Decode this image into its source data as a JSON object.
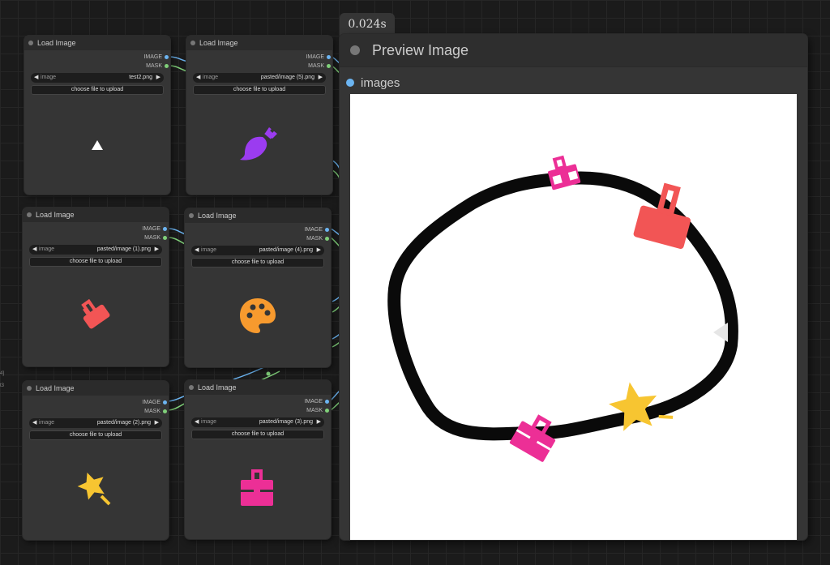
{
  "nodes": [
    {
      "title": "Load Image",
      "outputs": [
        "IMAGE",
        "MASK"
      ],
      "widget_label": "image",
      "widget_value": "test2.png",
      "upload_label": "choose file to upload",
      "thumb": "triangle-icon",
      "color": "#ffffff"
    },
    {
      "title": "Load Image",
      "outputs": [
        "IMAGE",
        "MASK"
      ],
      "widget_label": "image",
      "widget_value": "pasted/image (5).png",
      "upload_label": "choose file to upload",
      "thumb": "brush-icon",
      "color": "#9b3cf0"
    },
    {
      "title": "Load Image",
      "outputs": [
        "IMAGE",
        "MASK"
      ],
      "widget_label": "image",
      "widget_value": "pasted/image (1).png",
      "upload_label": "choose file to upload",
      "thumb": "paint-roller-icon",
      "color": "#f25555"
    },
    {
      "title": "Load Image",
      "outputs": [
        "IMAGE",
        "MASK"
      ],
      "widget_label": "image",
      "widget_value": "pasted/image (4).png",
      "upload_label": "choose file to upload",
      "thumb": "palette-icon",
      "color": "#f79a2e"
    },
    {
      "title": "Load Image",
      "outputs": [
        "IMAGE",
        "MASK"
      ],
      "widget_label": "image",
      "widget_value": "pasted/image (2).png",
      "upload_label": "choose file to upload",
      "thumb": "magic-wand-icon",
      "color": "#f7c531"
    },
    {
      "title": "Load Image",
      "outputs": [
        "IMAGE",
        "MASK"
      ],
      "widget_label": "image",
      "widget_value": "pasted/image (3).png",
      "upload_label": "choose file to upload",
      "thumb": "toolbox-icon",
      "color": "#ec2f96"
    }
  ],
  "preview": {
    "timing": "0.024s",
    "title": "Preview Image",
    "input_label": "images"
  },
  "colors": {
    "image_socket": "#6cb5f2",
    "mask_socket": "#80d07a",
    "node_bg": "#353535",
    "canvas_bg": "#ffffff"
  }
}
